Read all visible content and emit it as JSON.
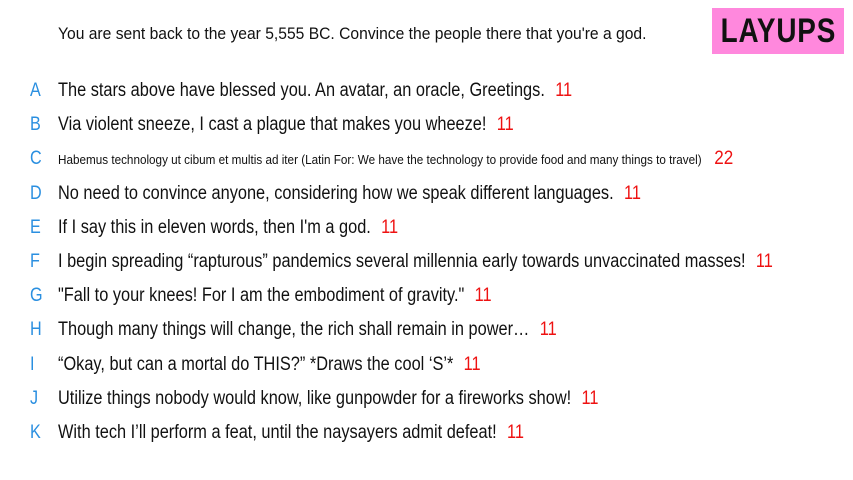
{
  "prompt": "You are sent back to the year 5,555 BC. Convince the people there that you're a god.",
  "badge": {
    "label": "LAYUPS",
    "color": "#ff88dd"
  },
  "colors": {
    "letter": "#2a8fe0",
    "score": "#ee1111",
    "text": "#111111"
  },
  "answers": [
    {
      "letter": "A",
      "text": "The stars above have blessed you. An avatar, an oracle, Greetings.",
      "score": "11"
    },
    {
      "letter": "B",
      "text": "Via violent sneeze, I cast a plague that makes you wheeze!",
      "score": "11"
    },
    {
      "letter": "C",
      "text": "Habemus technology ut cibum et multis ad iter (Latin For: We have the technology to provide food and many things to travel)",
      "score": "22"
    },
    {
      "letter": "D",
      "text": "No need to convince anyone, considering how we speak different languages.",
      "score": "11"
    },
    {
      "letter": "E",
      "text": "If I say this in eleven words, then I'm a god.",
      "score": "11"
    },
    {
      "letter": "F",
      "text": "I begin spreading “rapturous” pandemics several millennia early towards unvaccinated masses!",
      "score": "11"
    },
    {
      "letter": "G",
      "text": "\"Fall to your knees! For I am the embodiment of gravity.\"",
      "score": "11"
    },
    {
      "letter": "H",
      "text": "Though many things will change, the rich shall remain in power…",
      "score": "11"
    },
    {
      "letter": "I",
      "text": "“Okay, but can a mortal do THIS?” *Draws the cool ‘S’*",
      "score": "11"
    },
    {
      "letter": "J",
      "text": "Utilize things nobody would know, like gunpowder for a fireworks show!",
      "score": "11"
    },
    {
      "letter": "K",
      "text": "With tech I’ll perform a feat, until the naysayers admit defeat!",
      "score": "11"
    }
  ]
}
